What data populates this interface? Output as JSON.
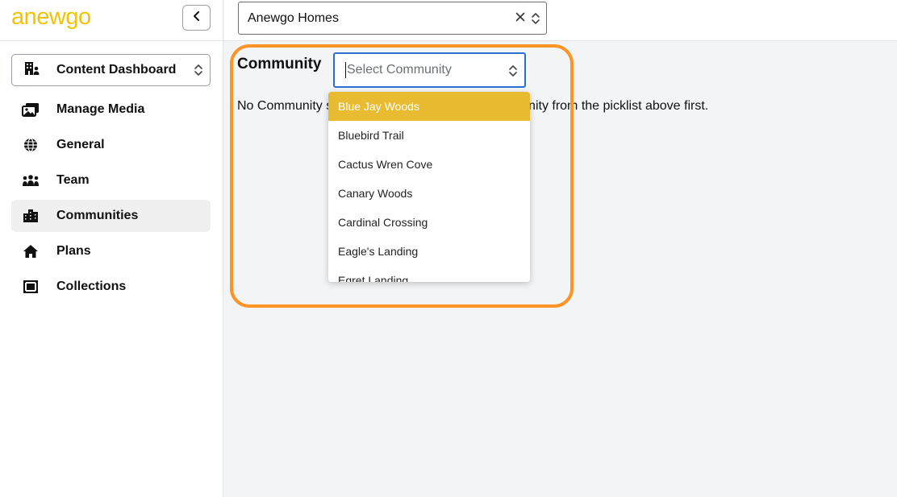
{
  "logo": {
    "text": "anewgo"
  },
  "sidebar": {
    "dashboard_select": {
      "label": "Content Dashboard",
      "icon": "building-person-icon"
    },
    "items": [
      {
        "label": "Manage Media",
        "icon": "images-icon",
        "active": false
      },
      {
        "label": "General",
        "icon": "globe-icon",
        "active": false
      },
      {
        "label": "Team",
        "icon": "people-icon",
        "active": false
      },
      {
        "label": "Communities",
        "icon": "city-icon",
        "active": true
      },
      {
        "label": "Plans",
        "icon": "home-icon",
        "active": false
      },
      {
        "label": "Collections",
        "icon": "collection-icon",
        "active": false
      }
    ]
  },
  "topbar": {
    "builder_select": {
      "value": "Anewgo Homes"
    }
  },
  "main": {
    "community_label": "Community",
    "community_select": {
      "placeholder": "Select Community"
    },
    "message": "No Community selected. Please select the Community from the picklist above first.",
    "dropdown_options": [
      "Blue Jay Woods",
      "Bluebird Trail",
      "Cactus Wren Cove",
      "Canary Woods",
      "Cardinal Crossing",
      "Eagle's Landing",
      "Egret Landing"
    ],
    "selected_index": 0
  },
  "colors": {
    "logo": "#f2c400",
    "highlight": "#ff9426",
    "selected_option": "#e9bb31",
    "focus_border": "#2c6ed4"
  }
}
